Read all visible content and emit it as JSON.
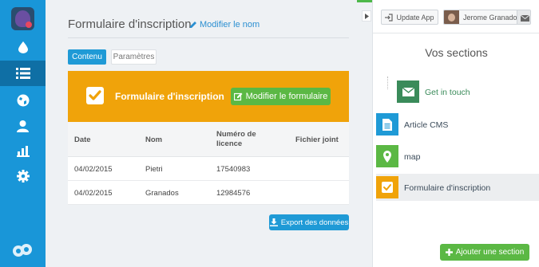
{
  "main": {
    "title": "Formulaire d'inscription",
    "rename_label": "Modifier le nom",
    "tabs": [
      {
        "label": "Contenu",
        "active": true
      },
      {
        "label": "Paramètres",
        "active": false
      }
    ],
    "banner": {
      "title": "Formulaire d'inscription",
      "edit_label": "Modifier le formulaire",
      "color": "#f0a30a"
    },
    "table": {
      "headers": [
        "Date",
        "Nom",
        "Numéro de licence",
        "Fichier joint"
      ],
      "header_lines": [
        "Numéro de",
        "licence"
      ],
      "rows": [
        [
          "04/02/2015",
          "Pietri",
          "17540983",
          ""
        ],
        [
          "04/02/2015",
          "Granados",
          "12984576",
          ""
        ]
      ]
    },
    "export_label": "Export des données"
  },
  "header": {
    "update_label": "Update App",
    "user_name": "Jerome Granados"
  },
  "sections": {
    "title": "Vos sections",
    "items": [
      {
        "label": "Get in touch",
        "icon": "envelope-icon",
        "color": "#3a8b5a"
      },
      {
        "label": "Article CMS",
        "icon": "document-icon",
        "color": "#1f9ad6"
      },
      {
        "label": "map",
        "icon": "map-marker-icon",
        "color": "#5bb844"
      },
      {
        "label": "Formulaire d'inscription",
        "icon": "checkbox-icon",
        "color": "#f0a30a",
        "active": true
      }
    ],
    "add_label": "Ajouter une section"
  },
  "colors": {
    "sidebar": "#1996d8",
    "accent_blue": "#1f9ad6",
    "green": "#5bb844",
    "orange": "#f0a30a"
  }
}
